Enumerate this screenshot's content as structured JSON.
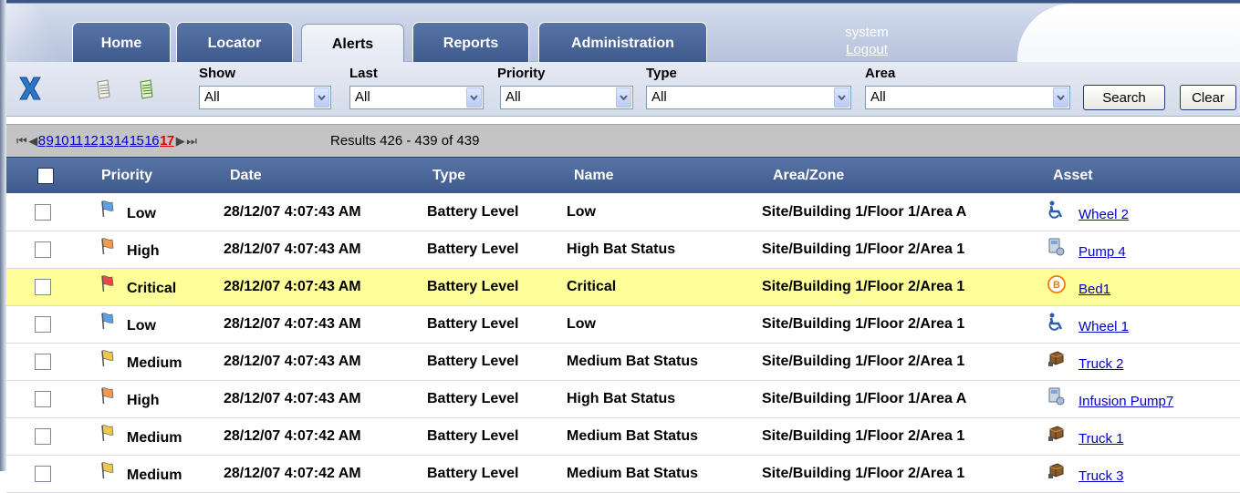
{
  "tabs": [
    {
      "label": "Home",
      "active": false
    },
    {
      "label": "Locator",
      "active": false
    },
    {
      "label": "Alerts",
      "active": true
    },
    {
      "label": "Reports",
      "active": false
    },
    {
      "label": "Administration",
      "active": false
    }
  ],
  "user": {
    "name": "system",
    "logout": "Logout"
  },
  "filters": {
    "show": {
      "label": "Show",
      "value": "All"
    },
    "last": {
      "label": "Last",
      "value": "All"
    },
    "priority": {
      "label": "Priority",
      "value": "All"
    },
    "type": {
      "label": "Type",
      "value": "All"
    },
    "area": {
      "label": "Area",
      "value": "All"
    },
    "search_label": "Search",
    "clear_label": "Clear"
  },
  "pager": {
    "pages": [
      "8",
      "9",
      "10",
      "11",
      "12",
      "13",
      "14",
      "15",
      "16",
      "17"
    ],
    "current": "17",
    "results": "Results 426 - 439 of 439"
  },
  "table": {
    "headers": {
      "priority": "Priority",
      "date": "Date",
      "type": "Type",
      "name": "Name",
      "area": "Area/Zone",
      "asset": "Asset"
    },
    "rows": [
      {
        "priority": "Low",
        "flag_color": "#5aa0e8",
        "date": "28/12/07 4:07:43 AM",
        "type": "Battery Level",
        "name": "Low",
        "area": "Site/Building 1/Floor 1/Area A",
        "asset_icon": "wheelchair-icon",
        "asset": "Wheel 2",
        "highlight": false
      },
      {
        "priority": "High",
        "flag_color": "#f09a50",
        "date": "28/12/07 4:07:43 AM",
        "type": "Battery Level",
        "name": "High Bat Status",
        "area": "Site/Building 1/Floor 2/Area 1",
        "asset_icon": "pump-icon",
        "asset": "Pump 4",
        "highlight": false
      },
      {
        "priority": "Critical",
        "flag_color": "#e84848",
        "date": "28/12/07 4:07:43 AM",
        "type": "Battery Level",
        "name": "Critical",
        "area": "Site/Building 1/Floor 2/Area 1",
        "asset_icon": "bed-icon",
        "asset": "Bed1",
        "highlight": true
      },
      {
        "priority": "Low",
        "flag_color": "#5aa0e8",
        "date": "28/12/07 4:07:43 AM",
        "type": "Battery Level",
        "name": "Low",
        "area": "Site/Building 1/Floor 2/Area 1",
        "asset_icon": "wheelchair-icon",
        "asset": "Wheel 1",
        "highlight": false
      },
      {
        "priority": "Medium",
        "flag_color": "#ecc94a",
        "date": "28/12/07 4:07:43 AM",
        "type": "Battery Level",
        "name": "Medium Bat Status",
        "area": "Site/Building 1/Floor 2/Area 1",
        "asset_icon": "truck-icon",
        "asset": "Truck 2",
        "highlight": false
      },
      {
        "priority": "High",
        "flag_color": "#f09a50",
        "date": "28/12/07 4:07:43 AM",
        "type": "Battery Level",
        "name": "High Bat Status",
        "area": "Site/Building 1/Floor 1/Area A",
        "asset_icon": "pump-icon",
        "asset": "Infusion Pump7",
        "highlight": false
      },
      {
        "priority": "Medium",
        "flag_color": "#ecc94a",
        "date": "28/12/07 4:07:42 AM",
        "type": "Battery Level",
        "name": "Medium Bat Status",
        "area": "Site/Building 1/Floor 2/Area 1",
        "asset_icon": "truck-icon",
        "asset": "Truck 1",
        "highlight": false
      },
      {
        "priority": "Medium",
        "flag_color": "#ecc94a",
        "date": "28/12/07 4:07:42 AM",
        "type": "Battery Level",
        "name": "Medium Bat Status",
        "area": "Site/Building 1/Floor 2/Area 1",
        "asset_icon": "truck-icon",
        "asset": "Truck 3",
        "highlight": false
      }
    ]
  }
}
